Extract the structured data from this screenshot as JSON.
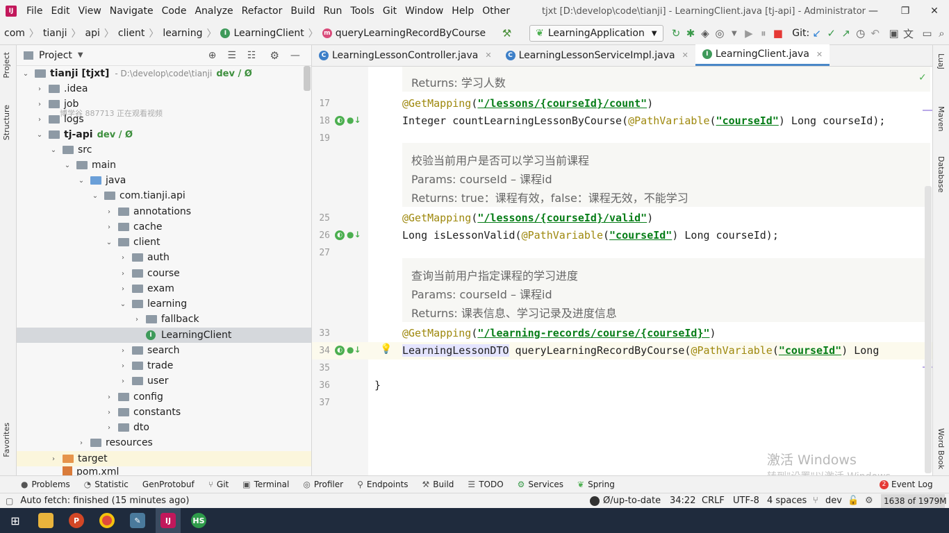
{
  "menu": {
    "items": [
      "File",
      "Edit",
      "View",
      "Navigate",
      "Code",
      "Analyze",
      "Refactor",
      "Build",
      "Run",
      "Tools",
      "Git",
      "Window",
      "Help",
      "Other"
    ],
    "window_title": "tjxt [D:\\develop\\code\\tianji] - LearningClient.java [tj-api] - Administrator"
  },
  "breadcrumb": {
    "items": [
      "com",
      "tianji",
      "api",
      "client",
      "learning",
      "LearningClient",
      "queryLearningRecordByCourse"
    ]
  },
  "toolbar": {
    "run_config": "LearningApplication",
    "git_label": "Git:"
  },
  "side_tabs": {
    "project": "Project",
    "structure": "Structure",
    "favorites": "Favorites",
    "luaj": "LuaJ",
    "maven": "Maven",
    "database": "Database",
    "word_book": "Word Book"
  },
  "project": {
    "title": "Project",
    "root_label": "tianji [tjxt]",
    "root_path": "- D:\\develop\\code\\tianji",
    "root_vcs": "dev / Ø",
    "overlay_text": "博学谷 887713 正在观看视频",
    "tree": [
      {
        "label": "tianji [tjxt]",
        "kind": "root"
      },
      {
        "label": ".idea"
      },
      {
        "label": "job"
      },
      {
        "label": "logs"
      },
      {
        "label": "tj-api",
        "vcs": "dev / Ø"
      },
      {
        "label": "src"
      },
      {
        "label": "main"
      },
      {
        "label": "java"
      },
      {
        "label": "com.tianji.api"
      },
      {
        "label": "annotations"
      },
      {
        "label": "cache"
      },
      {
        "label": "client"
      },
      {
        "label": "auth"
      },
      {
        "label": "course"
      },
      {
        "label": "exam"
      },
      {
        "label": "learning"
      },
      {
        "label": "fallback"
      },
      {
        "label": "LearningClient"
      },
      {
        "label": "search"
      },
      {
        "label": "trade"
      },
      {
        "label": "user"
      },
      {
        "label": "config"
      },
      {
        "label": "constants"
      },
      {
        "label": "dto"
      },
      {
        "label": "resources"
      },
      {
        "label": "target"
      },
      {
        "label": "pom.xml"
      }
    ]
  },
  "tabs": [
    {
      "label": "LearningLessonController.java",
      "active": false
    },
    {
      "label": "LearningLessonServiceImpl.java",
      "active": false
    },
    {
      "label": "LearningClient.java",
      "active": true
    }
  ],
  "editor": {
    "line_numbers": [
      "17",
      "18",
      "19",
      "25",
      "26",
      "27",
      "33",
      "34",
      "35",
      "36",
      "37"
    ],
    "doc1_returns": "Returns: 学习人数",
    "mapping1": "@GetMapping(\"/lessons/{courseId}/count\")",
    "method1": "Integer countLearningLessonByCourse(@PathVariable(\"courseId\") Long courseId);",
    "doc2": [
      "校验当前用户是否可以学习当前课程",
      "Params: courseId – 课程id",
      "Returns: true：课程有效，false：课程无效，不能学习"
    ],
    "mapping2": "@GetMapping(\"/lessons/{courseId}/valid\")",
    "method2": "Long isLessonValid(@PathVariable(\"courseId\") Long courseId);",
    "doc3": [
      "查询当前用户指定课程的学习进度",
      "Params: courseId – 课程id",
      "Returns: 课表信息、学习记录及进度信息"
    ],
    "mapping3": "@GetMapping(\"/learning-records/course/{courseId}\")",
    "method3": "LearningLessonDTO queryLearningRecordByCourse(@PathVariable(\"courseId\") Long",
    "closing": "}"
  },
  "watermark": {
    "line1": "激活 Windows",
    "line2": "转到\"设置\"以激活 Windows。"
  },
  "bottom_tabs": [
    "Problems",
    "Statistic",
    "GenProtobuf",
    "Git",
    "Terminal",
    "Profiler",
    "Endpoints",
    "Build",
    "TODO",
    "Services",
    "Spring"
  ],
  "event_log": {
    "label": "Event Log",
    "count": "2"
  },
  "status": {
    "message": "Auto fetch: finished (15 minutes ago)",
    "vcs": "Ø/up-to-date",
    "position": "34:22",
    "line_sep": "CRLF",
    "encoding": "UTF-8",
    "indent": "4 spaces",
    "branch": "dev",
    "memory": "1638 of 1979M"
  }
}
